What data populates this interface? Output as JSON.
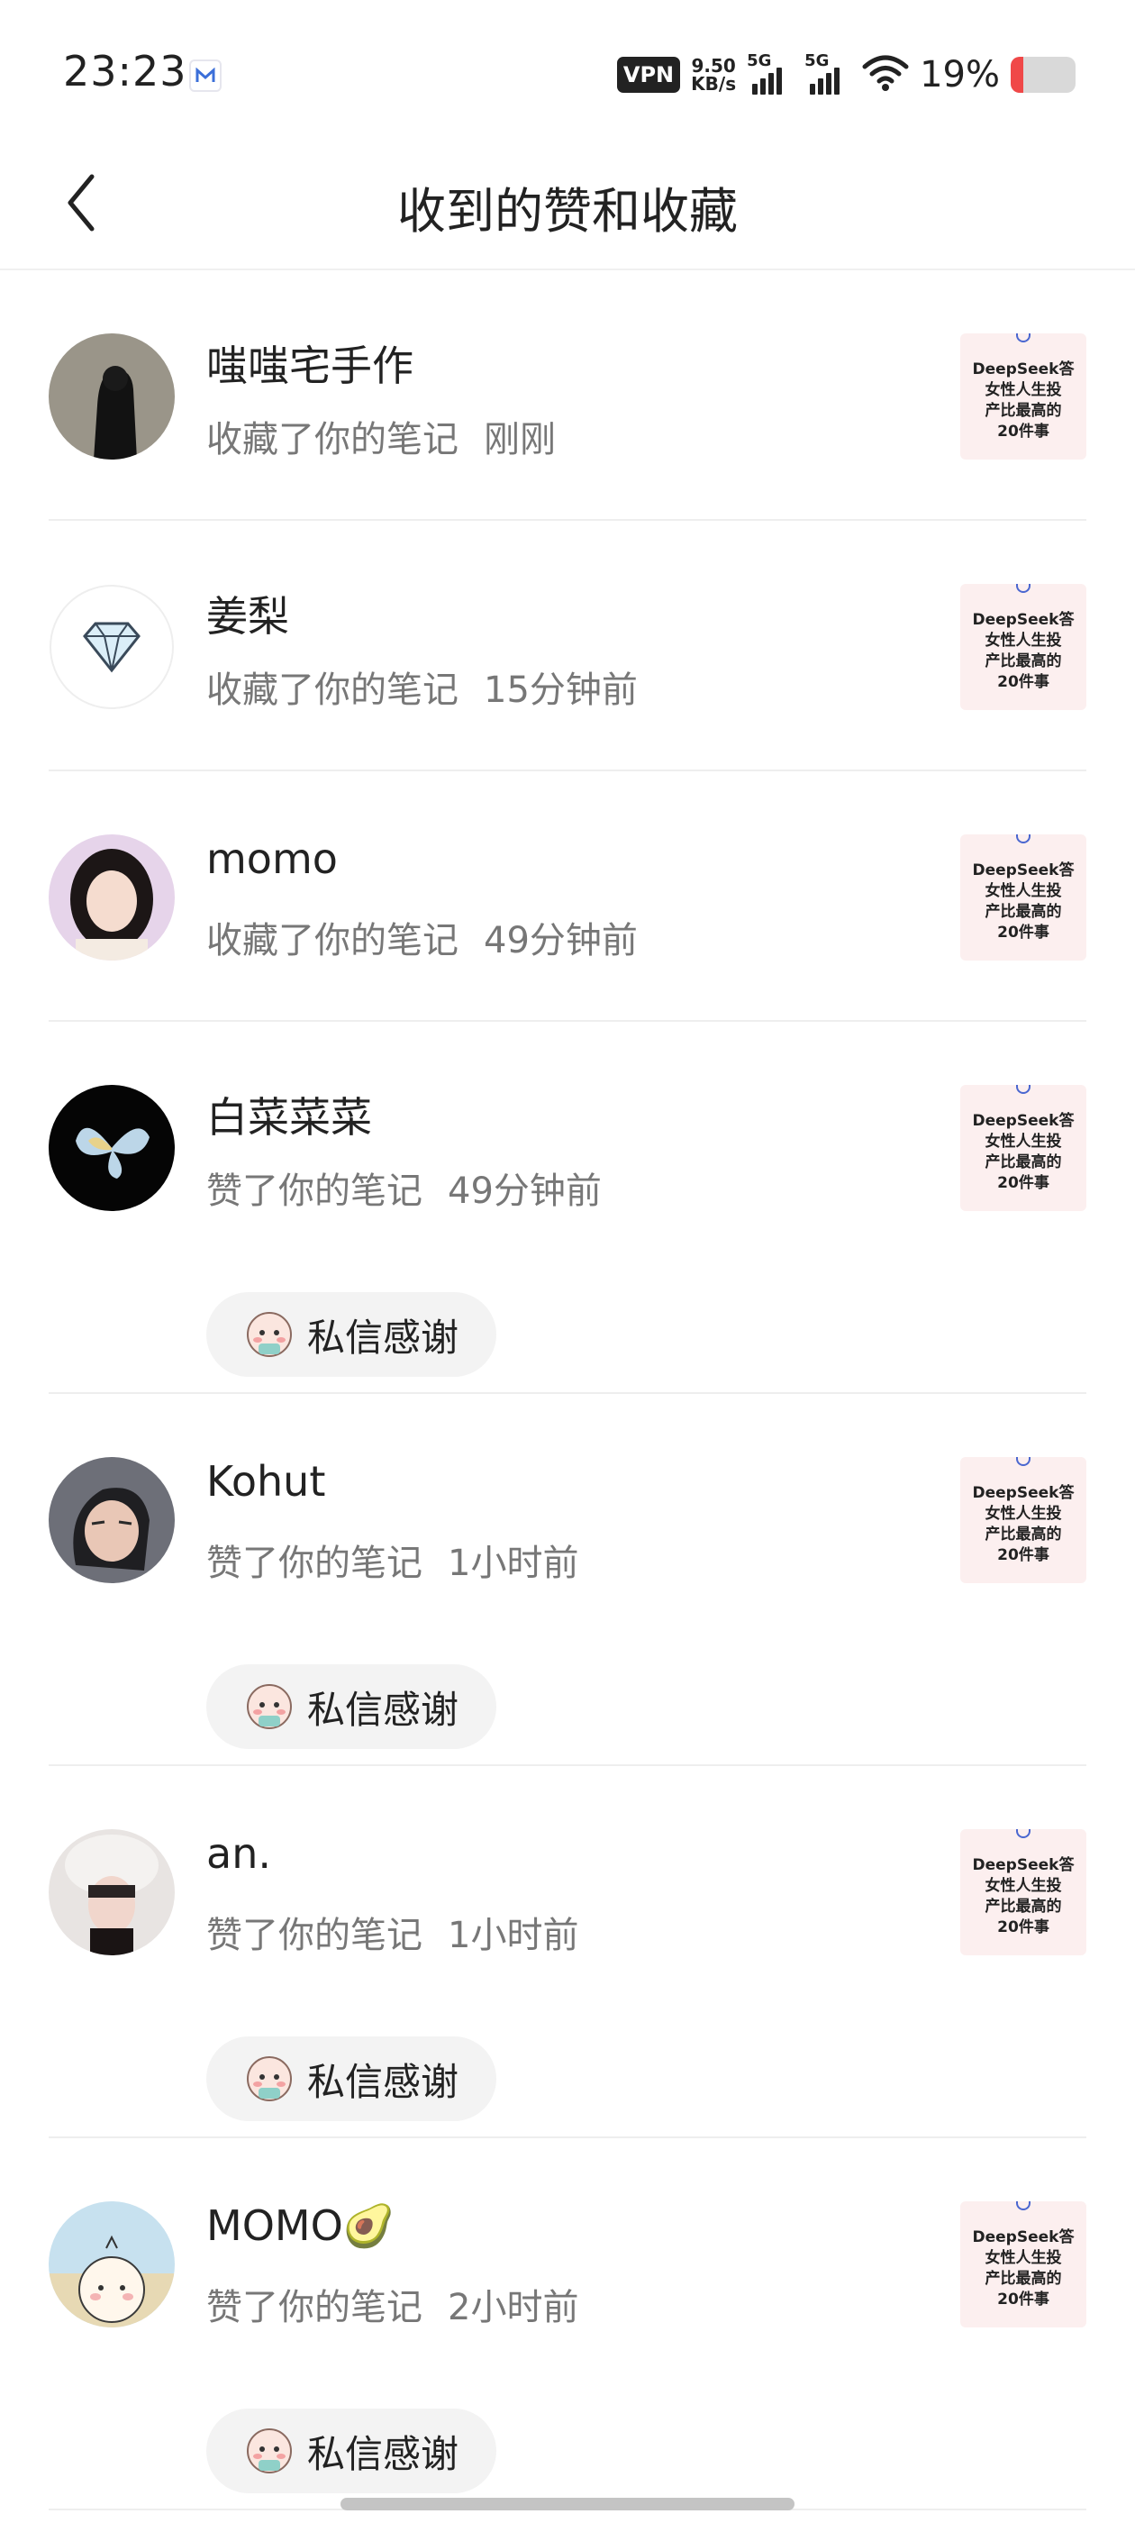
{
  "status_bar": {
    "time": "23:23",
    "vpn": "VPN",
    "speed_value": "9.50",
    "speed_unit": "KB/s",
    "net1": "5G",
    "net2": "5G",
    "battery_pct": "19%",
    "battery_level": 0.19,
    "battery_color": "#f04848"
  },
  "header": {
    "title": "收到的赞和收藏",
    "back_icon": "chevron-left-icon"
  },
  "thumb_text": "DeepSeek答\n女性人生投\n产比最高的\n20件事",
  "thanks_label": "私信感谢",
  "items": [
    {
      "name": "嗤嗤宅手作",
      "action": "收藏了你的笔记",
      "time": "刚刚",
      "thanks": false
    },
    {
      "name": "姜梨",
      "action": "收藏了你的笔记",
      "time": "15分钟前",
      "thanks": false
    },
    {
      "name": "momo",
      "action": "收藏了你的笔记",
      "time": "49分钟前",
      "thanks": false
    },
    {
      "name": "白菜菜菜",
      "action": "赞了你的笔记",
      "time": "49分钟前",
      "thanks": true
    },
    {
      "name": "Kohut",
      "action": "赞了你的笔记",
      "time": "1小时前",
      "thanks": true
    },
    {
      "name": "an.",
      "action": "赞了你的笔记",
      "time": "1小时前",
      "thanks": true
    },
    {
      "name": "MOMO🥑",
      "action": "赞了你的笔记",
      "time": "2小时前",
      "thanks": true
    }
  ]
}
